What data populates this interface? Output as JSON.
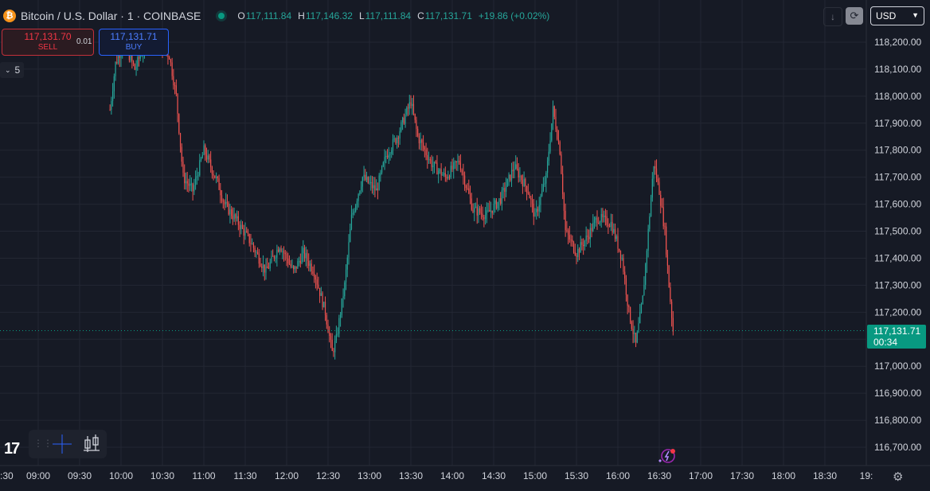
{
  "header": {
    "symbol_title": "Bitcoin / U.S. Dollar · 1 · COINBASE",
    "ohlc": [
      {
        "key": "O",
        "value": "117,111.84"
      },
      {
        "key": "H",
        "value": "117,146.32"
      },
      {
        "key": "L",
        "value": "117,111.84"
      },
      {
        "key": "C",
        "value": "117,131.71"
      }
    ],
    "change": "+19.86 (+0.02%)",
    "icon": "bitcoin-icon"
  },
  "trading": {
    "sell_price": "117,131.70",
    "sell_label": "SELL",
    "spread": "0.01",
    "buy_price": "117,131.71",
    "buy_label": "BUY"
  },
  "indicators": {
    "toggle_label": "5"
  },
  "toolbar": {
    "currency": "USD"
  },
  "last_price": {
    "price": "117,131.71",
    "countdown": "00:34"
  },
  "colors": {
    "up": "#26A69A",
    "down": "#EF5350",
    "background": "#161A25",
    "grid": "#262A35",
    "accent": "#089981"
  },
  "chart_data": {
    "type": "candlestick",
    "y_ticks": [
      "118,200.00",
      "118,100.00",
      "118,000.00",
      "117,900.00",
      "117,800.00",
      "117,700.00",
      "117,600.00",
      "117,500.00",
      "117,400.00",
      "117,300.00",
      "117,200.00",
      "117,000.00",
      "116,900.00",
      "116,800.00",
      "116,700.00"
    ],
    "y_tick_values": [
      118200,
      118100,
      118000,
      117900,
      117800,
      117700,
      117600,
      117500,
      117400,
      117300,
      117200,
      117000,
      116900,
      116800,
      116700
    ],
    "x_ticks": [
      ":30",
      "09:00",
      "09:30",
      "10:00",
      "10:30",
      "11:00",
      "11:30",
      "12:00",
      "12:30",
      "13:00",
      "13:30",
      "14:00",
      "14:30",
      "15:00",
      "15:30",
      "16:00",
      "16:30",
      "17:00",
      "17:30",
      "18:00",
      "18:30",
      "19:"
    ],
    "ylim": [
      116650,
      118280
    ],
    "price_path": [
      {
        "t": "09:52",
        "v": 117950
      },
      {
        "t": "09:56",
        "v": 118120
      },
      {
        "t": "10:02",
        "v": 118200
      },
      {
        "t": "10:10",
        "v": 118100
      },
      {
        "t": "10:20",
        "v": 118230
      },
      {
        "t": "10:35",
        "v": 118150
      },
      {
        "t": "10:40",
        "v": 118000
      },
      {
        "t": "10:45",
        "v": 117700
      },
      {
        "t": "10:52",
        "v": 117650
      },
      {
        "t": "11:00",
        "v": 117800
      },
      {
        "t": "11:10",
        "v": 117680
      },
      {
        "t": "11:15",
        "v": 117600
      },
      {
        "t": "11:25",
        "v": 117530
      },
      {
        "t": "11:35",
        "v": 117450
      },
      {
        "t": "11:45",
        "v": 117350
      },
      {
        "t": "11:55",
        "v": 117450
      },
      {
        "t": "12:05",
        "v": 117350
      },
      {
        "t": "12:12",
        "v": 117420
      },
      {
        "t": "12:20",
        "v": 117350
      },
      {
        "t": "12:28",
        "v": 117200
      },
      {
        "t": "12:33",
        "v": 117050
      },
      {
        "t": "12:36",
        "v": 117100
      },
      {
        "t": "12:42",
        "v": 117300
      },
      {
        "t": "12:47",
        "v": 117550
      },
      {
        "t": "12:55",
        "v": 117700
      },
      {
        "t": "13:05",
        "v": 117650
      },
      {
        "t": "13:12",
        "v": 117780
      },
      {
        "t": "13:20",
        "v": 117850
      },
      {
        "t": "13:30",
        "v": 117980
      },
      {
        "t": "13:35",
        "v": 117850
      },
      {
        "t": "13:45",
        "v": 117750
      },
      {
        "t": "13:55",
        "v": 117700
      },
      {
        "t": "14:05",
        "v": 117760
      },
      {
        "t": "14:15",
        "v": 117580
      },
      {
        "t": "14:25",
        "v": 117560
      },
      {
        "t": "14:35",
        "v": 117620
      },
      {
        "t": "14:45",
        "v": 117740
      },
      {
        "t": "14:55",
        "v": 117650
      },
      {
        "t": "15:00",
        "v": 117550
      },
      {
        "t": "15:08",
        "v": 117700
      },
      {
        "t": "15:13",
        "v": 117950
      },
      {
        "t": "15:18",
        "v": 117800
      },
      {
        "t": "15:22",
        "v": 117500
      },
      {
        "t": "15:30",
        "v": 117420
      },
      {
        "t": "15:38",
        "v": 117480
      },
      {
        "t": "15:45",
        "v": 117550
      },
      {
        "t": "15:55",
        "v": 117530
      },
      {
        "t": "16:03",
        "v": 117400
      },
      {
        "t": "16:08",
        "v": 117200
      },
      {
        "t": "16:13",
        "v": 117080
      },
      {
        "t": "16:18",
        "v": 117250
      },
      {
        "t": "16:22",
        "v": 117500
      },
      {
        "t": "16:26",
        "v": 117750
      },
      {
        "t": "16:30",
        "v": 117650
      },
      {
        "t": "16:34",
        "v": 117500
      },
      {
        "t": "16:37",
        "v": 117300
      },
      {
        "t": "16:40",
        "v": 117131.71
      }
    ],
    "last_price": 117131.71,
    "grid": true
  }
}
